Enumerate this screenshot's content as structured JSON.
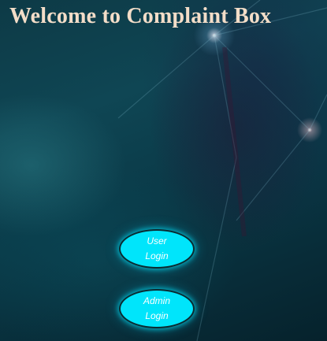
{
  "page": {
    "title": "Welcome to Complaint Box"
  },
  "buttons": {
    "user": {
      "line1": "User",
      "line2": "Login"
    },
    "admin": {
      "line1": "Admin",
      "line2": "Login"
    }
  },
  "colors": {
    "title_text": "#f3ddc8",
    "button_fill": "#00e5fb",
    "button_border": "#0b2a30",
    "background": "#0d3a46"
  }
}
